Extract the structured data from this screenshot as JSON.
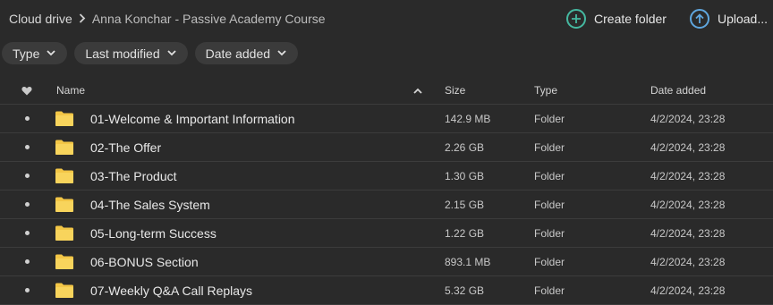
{
  "breadcrumb": {
    "root": "Cloud drive",
    "separator": ">",
    "current": "Anna Konchar - Passive Academy Course"
  },
  "actions": {
    "create_folder": "Create folder",
    "upload": "Upload..."
  },
  "filters": [
    {
      "label": "Type"
    },
    {
      "label": "Last modified"
    },
    {
      "label": "Date added"
    }
  ],
  "table": {
    "headers": {
      "name": "Name",
      "size": "Size",
      "type": "Type",
      "date_added": "Date added"
    },
    "rows": [
      {
        "name": "01-Welcome & Important Information",
        "size": "142.9 MB",
        "type": "Folder",
        "date_added": "4/2/2024, 23:28"
      },
      {
        "name": "02-The Offer",
        "size": "2.26 GB",
        "type": "Folder",
        "date_added": "4/2/2024, 23:28"
      },
      {
        "name": "03-The Product",
        "size": "1.30 GB",
        "type": "Folder",
        "date_added": "4/2/2024, 23:28"
      },
      {
        "name": "04-The Sales System",
        "size": "2.15 GB",
        "type": "Folder",
        "date_added": "4/2/2024, 23:28"
      },
      {
        "name": "05-Long-term Success",
        "size": "1.22 GB",
        "type": "Folder",
        "date_added": "4/2/2024, 23:28"
      },
      {
        "name": "06-BONUS Section",
        "size": "893.1 MB",
        "type": "Folder",
        "date_added": "4/2/2024, 23:28"
      },
      {
        "name": "07-Weekly Q&A Call Replays",
        "size": "5.32 GB",
        "type": "Folder",
        "date_added": "4/2/2024, 23:28"
      }
    ]
  },
  "icons": {
    "create_folder": "plus-circle-icon",
    "upload": "arrow-up-circle-icon",
    "favourite_header": "heart-icon",
    "sort": "sort-ascending-icon",
    "folder": "folder-icon",
    "chip": "chevron-down-icon"
  },
  "colors": {
    "background": "#2a2a2a",
    "chip_background": "#3b3b3b",
    "create_folder_accent": "#45b8a0",
    "upload_accent": "#5fa6de",
    "folder_yellow": "#f3c646"
  }
}
